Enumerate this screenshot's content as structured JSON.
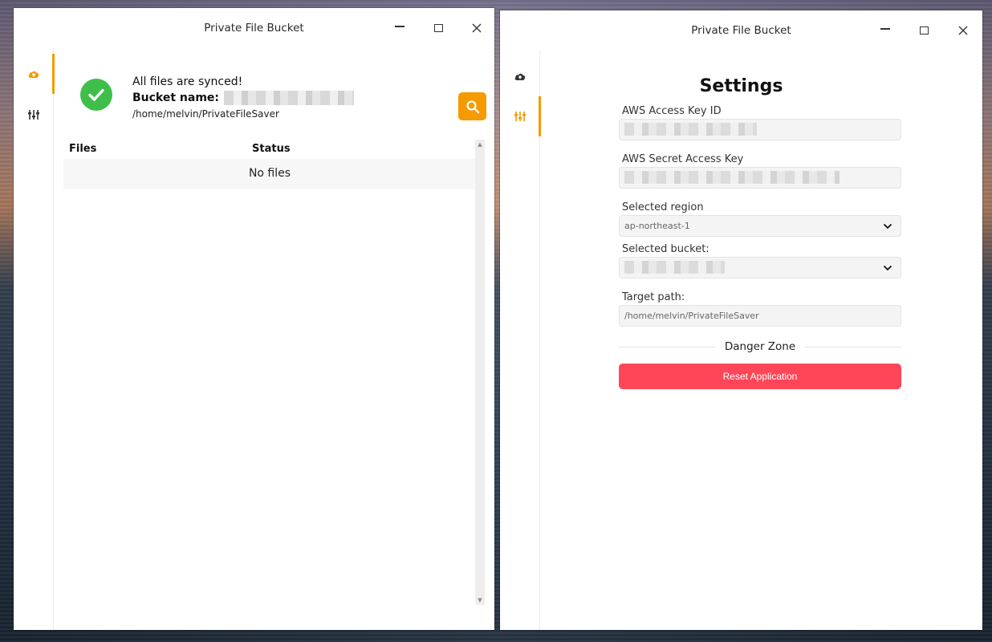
{
  "colors": {
    "accent": "#f59a00",
    "success": "#3fbf4a",
    "danger": "#ff4658"
  },
  "left_window": {
    "title": "Private File Bucket",
    "controls": [
      "minimize-icon",
      "maximize-icon",
      "close-icon"
    ],
    "sidebar": [
      {
        "icon": "cloud-upload-icon",
        "active": true
      },
      {
        "icon": "sliders-icon",
        "active": false
      }
    ],
    "sync": {
      "status": "All files are synced!",
      "bucket_label": "Bucket name:",
      "path": "/home/melvin/PrivateFileSaver"
    },
    "search_icon": "search-icon",
    "table": {
      "headers": [
        "Files",
        "Status"
      ],
      "empty_text": "No files"
    }
  },
  "right_window": {
    "title": "Private File Bucket",
    "controls": [
      "minimize-icon",
      "maximize-icon",
      "close-icon"
    ],
    "sidebar": [
      {
        "icon": "cloud-upload-icon",
        "active": false
      },
      {
        "icon": "sliders-icon",
        "active": true
      }
    ],
    "settings": {
      "heading": "Settings",
      "access_key_label": "AWS Access Key ID",
      "secret_key_label": "AWS Secret Access Key",
      "region_label": "Selected region",
      "region_value": "ap-northeast-1",
      "bucket_label": "Selected bucket:",
      "target_path_label": "Target path:",
      "target_path_value": "/home/melvin/PrivateFileSaver",
      "danger_zone": "Danger Zone",
      "reset_button": "Reset Application"
    }
  }
}
